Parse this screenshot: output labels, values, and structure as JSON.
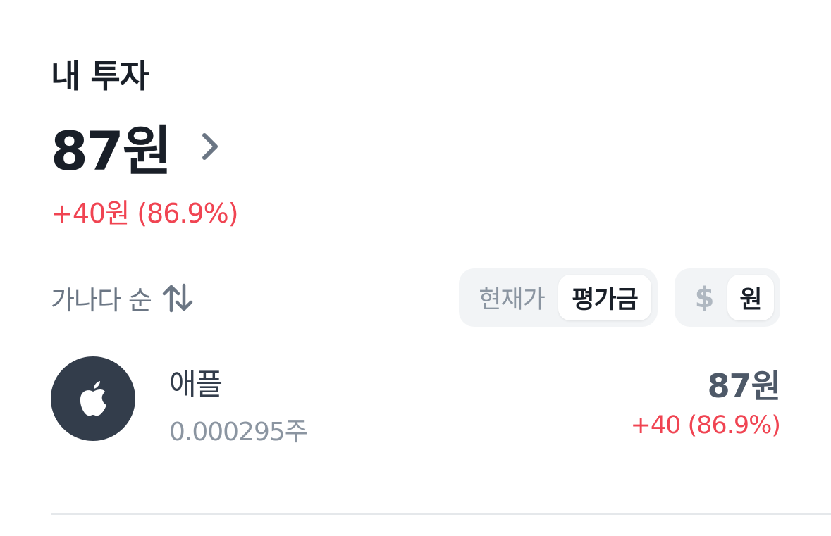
{
  "section": {
    "title": "내 투자"
  },
  "total": {
    "amount": "87원",
    "change": "+40원 (86.9%)"
  },
  "sort": {
    "label": "가나다 순"
  },
  "price_toggle": {
    "options": [
      "현재가",
      "평가금"
    ],
    "selected": "평가금"
  },
  "currency_toggle": {
    "options": [
      "$",
      "원"
    ],
    "selected": "원"
  },
  "holdings": [
    {
      "name": "애플",
      "quantity": "0.000295주",
      "value": "87원",
      "change": "+40 (86.9%)",
      "icon": "apple-logo-icon"
    }
  ],
  "colors": {
    "primary_text": "#191f28",
    "secondary_text": "#6b7684",
    "gain": "#f04452",
    "logo_bg": "#333d4b",
    "segment_bg": "#f2f4f6"
  }
}
